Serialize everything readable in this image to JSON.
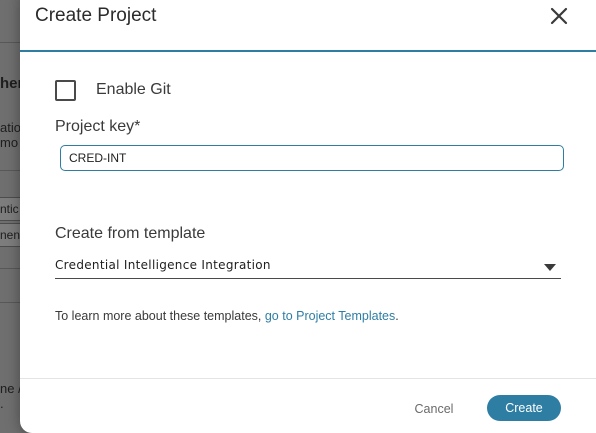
{
  "background": {
    "fragments": [
      {
        "text": "her",
        "bold": true
      },
      {
        "text": "atio"
      },
      {
        "text": "mo"
      },
      {
        "text": "ntic"
      },
      {
        "text": "nen"
      },
      {
        "text": "ne /"
      },
      {
        "text": "."
      }
    ]
  },
  "dialog": {
    "title": "Create Project",
    "close_icon": "close-icon"
  },
  "form": {
    "enable_git_label": "Enable Git",
    "enable_git_checked": false,
    "project_key_label": "Project key*",
    "project_key_value": "CRED-INT",
    "template_label": "Create from template",
    "template_value": "Credential Intelligence Integration",
    "help_prefix": "To learn more about these templates, ",
    "help_link": "go to Project Templates",
    "help_suffix": "."
  },
  "footer": {
    "cancel_label": "Cancel",
    "create_label": "Create"
  },
  "colors": {
    "accent": "#2e7ea4",
    "overlay": "#6f6f6f"
  }
}
